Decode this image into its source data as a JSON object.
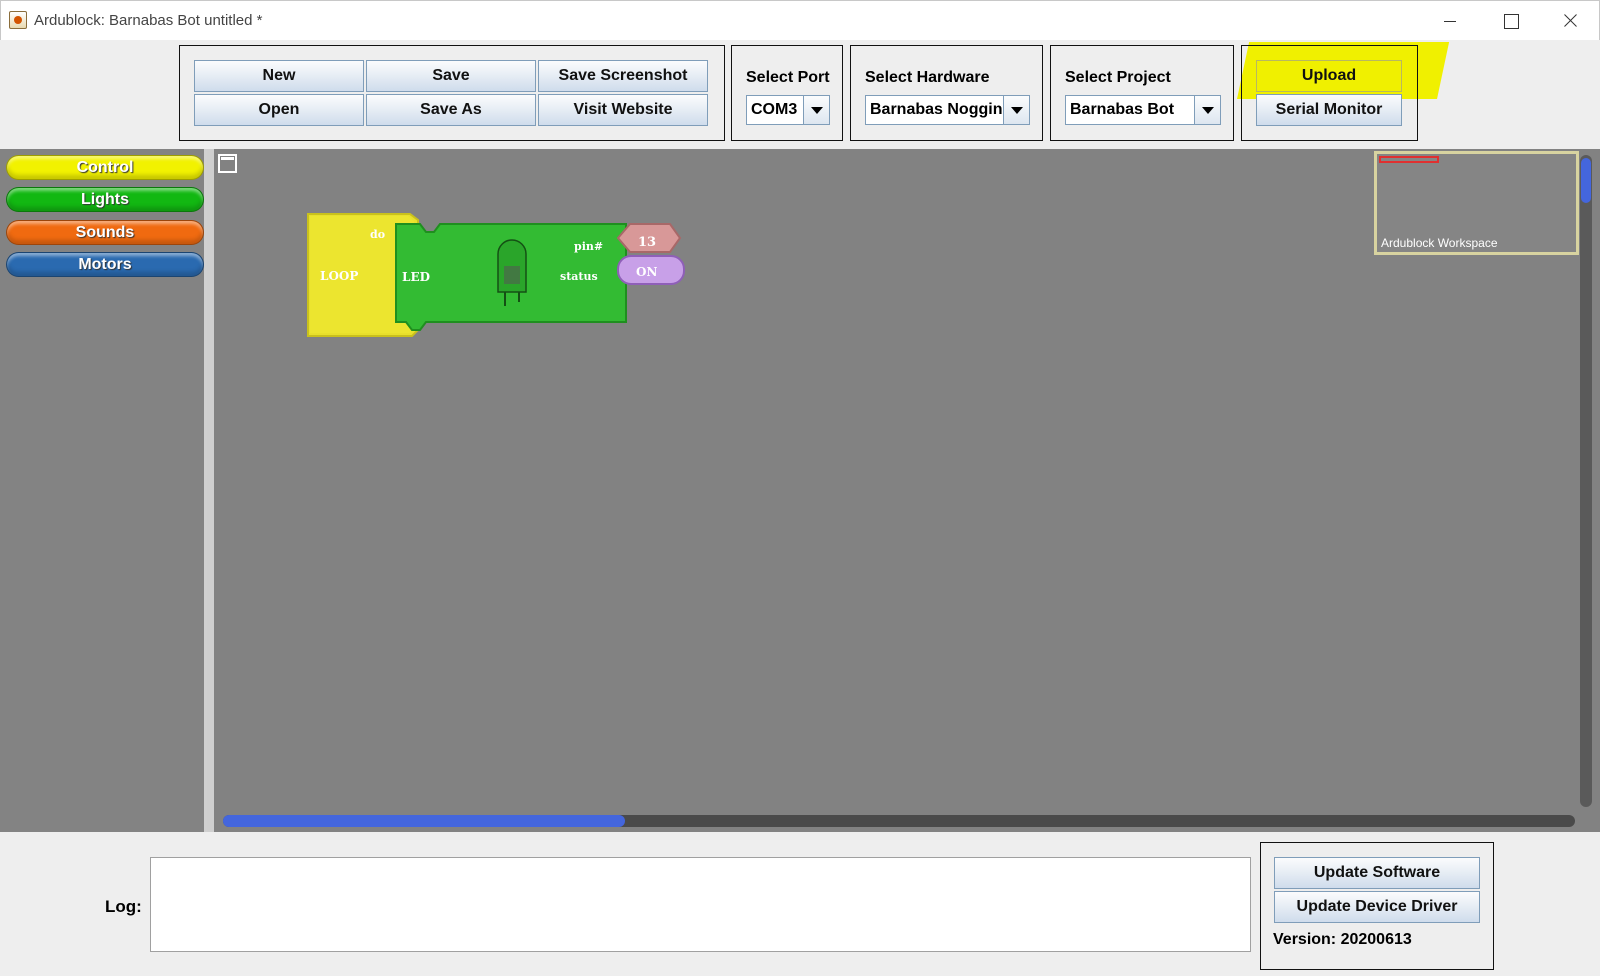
{
  "window": {
    "title": "Ardublock: Barnabas Bot untitled *"
  },
  "toolbar": {
    "file_buttons": {
      "new": "New",
      "save": "Save",
      "save_screenshot": "Save Screenshot",
      "open": "Open",
      "save_as": "Save As",
      "visit_website": "Visit Website"
    },
    "port": {
      "label": "Select Port",
      "value": "COM3"
    },
    "hardware": {
      "label": "Select Hardware",
      "value": "Barnabas Noggin"
    },
    "project": {
      "label": "Select Project",
      "value": "Barnabas Bot"
    },
    "upload": "Upload",
    "serial_monitor": "Serial Monitor",
    "highlight_color": "#f0f000"
  },
  "palette": {
    "categories": [
      {
        "label": "Control",
        "color": "#f2f200"
      },
      {
        "label": "Lights",
        "color": "#12b812"
      },
      {
        "label": "Sounds",
        "color": "#f06a10"
      },
      {
        "label": "Motors",
        "color": "#2a6ab0"
      }
    ]
  },
  "workspace": {
    "background": "#828282",
    "minimap_label": "Ardublock Workspace",
    "blocks": {
      "loop": {
        "label": "LOOP",
        "socket": "do",
        "color": "#e8e02c"
      },
      "led": {
        "label": "LED",
        "pin_label": "pin#",
        "status_label": "status",
        "color": "#33bb33"
      },
      "pin_value": {
        "label": "13",
        "color": "#d89898"
      },
      "status_value": {
        "label": "ON",
        "color": "#c8a0e8"
      }
    }
  },
  "bottom": {
    "log_label": "Log:",
    "log_text": "",
    "update_software": "Update Software",
    "update_driver": "Update Device Driver",
    "version": "Version: 20200613"
  }
}
